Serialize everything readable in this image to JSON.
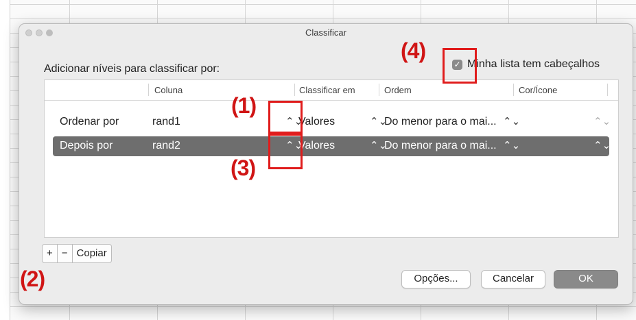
{
  "dialog": {
    "title": "Classificar",
    "heading": "Adicionar níveis para classificar por:",
    "header_checkbox": {
      "label": "Minha lista tem cabeçalhos",
      "checked": true,
      "check_glyph": "✓"
    }
  },
  "table": {
    "columns": [
      "Coluna",
      "Classificar em",
      "Ordem",
      "Cor/Ícone"
    ],
    "rows": [
      {
        "level": "Ordenar por",
        "column": "rand1",
        "sort_on": "Valores",
        "order": "Do menor para o mai...",
        "color_icon": "",
        "selected": false
      },
      {
        "level": "Depois por",
        "column": "rand2",
        "sort_on": "Valores",
        "order": "Do menor para o mai...",
        "color_icon": "",
        "selected": true
      }
    ],
    "popup_arrow_glyph": "⌃⌄"
  },
  "buttons": {
    "add": "+",
    "remove": "−",
    "copy": "Copiar",
    "options": "Opções...",
    "cancel": "Cancelar",
    "ok": "OK"
  },
  "annotations": [
    "(1)",
    "(2)",
    "(3)",
    "(4)"
  ],
  "colors": {
    "annotation": "#d01515",
    "selected_row": "#6e6e6e",
    "ok_button": "#8a8a8a"
  }
}
